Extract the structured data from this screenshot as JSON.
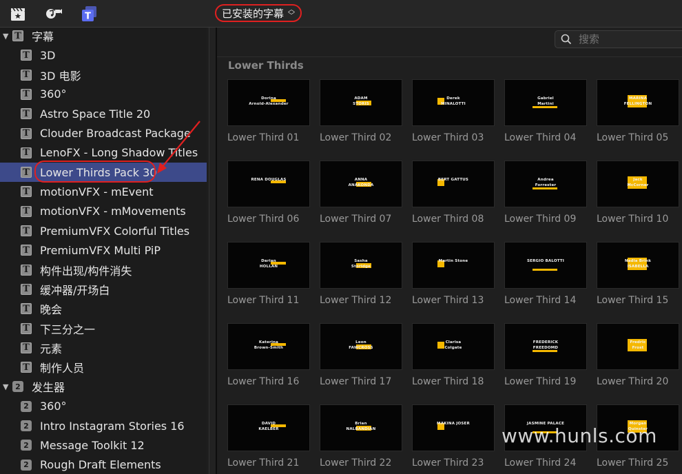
{
  "top_bar": {
    "icons": [
      "clapper-icon",
      "music-camera-icon",
      "titles-icon"
    ],
    "selector_label": "已安装的字幕",
    "selector_chevron": "⌃⌄"
  },
  "sidebar": {
    "groups": [
      {
        "label": "字幕",
        "expanded": true,
        "icon": "title-T-icon",
        "items": [
          "3D",
          "3D 电影",
          "360°",
          "Astro Space Title 20",
          "Clouder Broadcast Package",
          "LenoFX - Long Shadow Titles",
          "Lower Thirds Pack 30",
          "motionVFX - mEvent",
          "motionVFX - mMovements",
          "PremiumVFX Colorful Titles",
          "PremiumVFX Multi PiP",
          "构件出现/构件消失",
          "缓冲器/开场白",
          "晚会",
          "下三分之一",
          "元素",
          "制作人员"
        ],
        "selected_index": 6
      },
      {
        "label": "发生器",
        "expanded": true,
        "icon": "generator-icon",
        "items": [
          "360°",
          "Intro Instagram Stories 16",
          "Message Toolkit 12",
          "Rough Draft Elements"
        ]
      }
    ]
  },
  "browser": {
    "search_placeholder": "搜索",
    "section_title": "Lower Thirds",
    "tiles": [
      {
        "caption": "Lower Third 01",
        "text": [
          "Dorina",
          "Arnold-Alexander"
        ]
      },
      {
        "caption": "Lower Third 02",
        "text": [
          "ADAM",
          "STORIS"
        ]
      },
      {
        "caption": "Lower Third 03",
        "text": [
          "Derek",
          "MINALOTTI"
        ]
      },
      {
        "caption": "Lower Third 04",
        "text": [
          "Gabriel",
          "Martini"
        ]
      },
      {
        "caption": "Lower Third 05",
        "text": [
          "MARINA",
          "FELLINGTON"
        ]
      },
      {
        "caption": "Lower Third 06",
        "text": [
          "RENA DOUGLAS",
          ""
        ]
      },
      {
        "caption": "Lower Third 07",
        "text": [
          "ANNA",
          "ANAKONDA"
        ]
      },
      {
        "caption": "Lower Third 08",
        "text": [
          "BERT GATTUS",
          ""
        ]
      },
      {
        "caption": "Lower Third 09",
        "text": [
          "Andrea",
          "Forrester"
        ]
      },
      {
        "caption": "Lower Third 10",
        "text": [
          "Jack",
          "McCorner"
        ]
      },
      {
        "caption": "Lower Third 11",
        "text": [
          "Darian",
          "HOLLAN"
        ]
      },
      {
        "caption": "Lower Third 12",
        "text": [
          "Sasha",
          "Storidge"
        ]
      },
      {
        "caption": "Lower Third 13",
        "text": [
          "Martin Stone",
          ""
        ]
      },
      {
        "caption": "Lower Third 14",
        "text": [
          "SERGIO BALOTTI",
          ""
        ]
      },
      {
        "caption": "Lower Third 15",
        "text": [
          "Nadia Brink",
          "ISABELLA"
        ]
      },
      {
        "caption": "Lower Third 16",
        "text": [
          "Katerina",
          "Brown-Smith"
        ]
      },
      {
        "caption": "Lower Third 17",
        "text": [
          "Leon",
          "FAWCROSS"
        ]
      },
      {
        "caption": "Lower Third 18",
        "text": [
          "Clarisa",
          "Colgate"
        ]
      },
      {
        "caption": "Lower Third 19",
        "text": [
          "FREDERICK",
          "FREEDOMD"
        ]
      },
      {
        "caption": "Lower Third 20",
        "text": [
          "Fredric",
          "Frost"
        ]
      },
      {
        "caption": "Lower Third 21",
        "text": [
          "DAVID",
          "KAELBER"
        ]
      },
      {
        "caption": "Lower Third 22",
        "text": [
          "Brian",
          "NALBANDIAN"
        ]
      },
      {
        "caption": "Lower Third 23",
        "text": [
          "MAKINA JOSER",
          ""
        ]
      },
      {
        "caption": "Lower Third 24",
        "text": [
          "JASMINE PALACE",
          ""
        ]
      },
      {
        "caption": "Lower Third 25",
        "text": [
          "Morgan",
          "Quinster"
        ]
      }
    ]
  },
  "watermark": "www.hunls.com",
  "colors": {
    "selection": "#3d4a8a",
    "accent_yellow": "#f5b800",
    "highlight_red": "#e02020",
    "titles_icon": "#5b6cf0"
  }
}
